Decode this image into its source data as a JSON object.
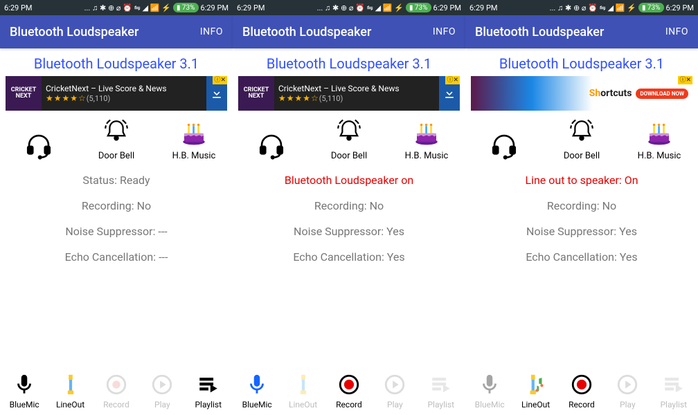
{
  "statusbar": {
    "time": "6:29 PM",
    "battery": "73%"
  },
  "appbar": {
    "title": "Bluetooth Loudspeaker",
    "info": "INFO"
  },
  "hero": "Bluetooth Loudspeaker 3.1",
  "ad1": {
    "logo": "CRICKET NEXT",
    "title": "CricketNext – Live Score & News",
    "stars": "★★★★☆",
    "count": "(5,110)",
    "badge": "ⓘ✕"
  },
  "ad2": {
    "brand": "Shortcuts",
    "download": "DOWNLOAD NOW",
    "badge": "ⓘ✕"
  },
  "icons": {
    "doorbell": "Door Bell",
    "hbmusic": "H.B. Music"
  },
  "screens": [
    {
      "status_line": "Status: Ready",
      "status_on": false,
      "recording": "Recording: No",
      "noise": "Noise Suppressor: ---",
      "echo": "Echo Cancellation: ---",
      "buttons": {
        "bluemic": {
          "label": "BlueMic",
          "active": false
        },
        "lineout": {
          "label": "LineOut",
          "active": false
        },
        "record": {
          "label": "Record",
          "active": false
        },
        "play": {
          "label": "Play",
          "active": false
        },
        "playlist": {
          "label": "Playlist",
          "active": true
        }
      }
    },
    {
      "status_line": "Bluetooth Loudspeaker on",
      "status_on": true,
      "recording": "Recording: No",
      "noise": "Noise Suppressor: Yes",
      "echo": "Echo Cancellation: Yes",
      "buttons": {
        "bluemic": {
          "label": "BlueMic",
          "active": true
        },
        "lineout": {
          "label": "LineOut",
          "active": false
        },
        "record": {
          "label": "Record",
          "active": true
        },
        "play": {
          "label": "Play",
          "active": false
        },
        "playlist": {
          "label": "Playlist",
          "active": false
        }
      }
    },
    {
      "status_line": "Line out to speaker: On",
      "status_on": true,
      "recording": "Recording: No",
      "noise": "Noise Suppressor: Yes",
      "echo": "Echo Cancellation: Yes",
      "buttons": {
        "bluemic": {
          "label": "BlueMic",
          "active": false
        },
        "lineout": {
          "label": "LineOut",
          "active": true
        },
        "record": {
          "label": "Record",
          "active": true
        },
        "play": {
          "label": "Play",
          "active": false
        },
        "playlist": {
          "label": "Playlist",
          "active": false
        }
      }
    }
  ]
}
